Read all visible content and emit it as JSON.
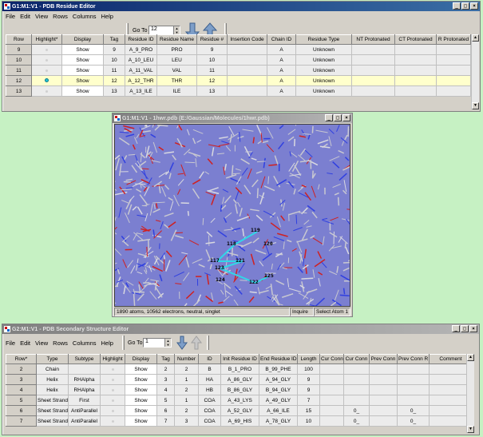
{
  "residue_editor": {
    "title": "G1:M1:V1 - PDB Residue Editor",
    "menu": [
      "File",
      "Edit",
      "View",
      "Rows",
      "Columns",
      "Help"
    ],
    "goto_label": "Go To",
    "goto_value": "12",
    "columns": [
      "Row",
      "Highlight*",
      "Display",
      "Tag",
      "Residue ID",
      "Residue Name",
      "Residue #",
      "Insertion Code",
      "Chain ID",
      "Residue Type",
      "NT Protonated",
      "CT Protonated",
      "R Protonated"
    ],
    "rows": [
      {
        "row": "9",
        "highlight": false,
        "display": "Show",
        "tag": "9",
        "id": "A_9_PRO",
        "name": "PRO",
        "num": "9",
        "ins": "",
        "chain": "A",
        "type": "Unknown"
      },
      {
        "row": "10",
        "highlight": false,
        "display": "Show",
        "tag": "10",
        "id": "A_10_LEU",
        "name": "LEU",
        "num": "10",
        "ins": "",
        "chain": "A",
        "type": "Unknown"
      },
      {
        "row": "11",
        "highlight": false,
        "display": "Show",
        "tag": "11",
        "id": "A_11_VAL",
        "name": "VAL",
        "num": "11",
        "ins": "",
        "chain": "A",
        "type": "Unknown"
      },
      {
        "row": "12",
        "highlight": true,
        "display": "Show",
        "tag": "12",
        "id": "A_12_THR",
        "name": "THR",
        "num": "12",
        "ins": "",
        "chain": "A",
        "type": "Unknown"
      },
      {
        "row": "13",
        "highlight": false,
        "display": "Show",
        "tag": "13",
        "id": "A_13_ILE",
        "name": "ILE",
        "num": "13",
        "ins": "",
        "chain": "A",
        "type": "Unknown"
      }
    ]
  },
  "molecule_view": {
    "title": "G1:M1:V1 - 1hwr.pdb (E:/Gaussian/Molecules/1hwr.pdb)",
    "labels": [
      "119",
      "118",
      "120",
      "117",
      "121",
      "123",
      "124",
      "122",
      "125"
    ],
    "status_info": "1890 atoms, 10562 electrons, neutral, singlet",
    "status_mode": "Inquire",
    "status_action": "Select Atom 1"
  },
  "secondary_editor": {
    "title": "G2:M1:V1 - PDB Secondary Structure Editor",
    "menu": [
      "File",
      "Edit",
      "View",
      "Rows",
      "Columns",
      "Help"
    ],
    "goto_label": "Go To",
    "goto_value": "1",
    "columns": [
      "Row*",
      "Type",
      "Subtype",
      "Highlight",
      "Display",
      "Tag",
      "Number",
      "ID",
      "Init Residue ID",
      "End Residue ID",
      "Length",
      "Cur Conn",
      "Cur Conn",
      "Prev Conn",
      "Prev Conn R",
      "Comment"
    ],
    "rows": [
      {
        "row": "2",
        "type": "Chain",
        "subtype": "",
        "display": "Show",
        "tag": "2",
        "number": "2",
        "id": "B",
        "init": "B_1_PRO",
        "end": "B_99_PHE",
        "length": "100",
        "c1": "",
        "c2": "",
        "p1": "",
        "p2": ""
      },
      {
        "row": "3",
        "type": "Helix",
        "subtype": "RHAlpha",
        "display": "Show",
        "tag": "3",
        "number": "1",
        "id": "HA",
        "init": "A_86_GLY",
        "end": "A_94_GLY",
        "length": "9",
        "c1": "",
        "c2": "",
        "p1": "",
        "p2": ""
      },
      {
        "row": "4",
        "type": "Helix",
        "subtype": "RHAlpha",
        "display": "Show",
        "tag": "4",
        "number": "2",
        "id": "HB",
        "init": "B_86_GLY",
        "end": "B_94_GLY",
        "length": "9",
        "c1": "",
        "c2": "",
        "p1": "",
        "p2": ""
      },
      {
        "row": "5",
        "type": "Sheet Strand",
        "subtype": "First",
        "display": "Show",
        "tag": "5",
        "number": "1",
        "id": "COA",
        "init": "A_43_LYS",
        "end": "A_49_GLY",
        "length": "7",
        "c1": "",
        "c2": "",
        "p1": "",
        "p2": ""
      },
      {
        "row": "6",
        "type": "Sheet Strand",
        "subtype": "AntiParallel",
        "display": "Show",
        "tag": "6",
        "number": "2",
        "id": "COA",
        "init": "A_52_GLY",
        "end": "A_66_ILE",
        "length": "15",
        "c1": "",
        "c2": "0_",
        "p1": "",
        "p2": "0_"
      },
      {
        "row": "7",
        "type": "Sheet Strand",
        "subtype": "AntiParallel",
        "display": "Show",
        "tag": "7",
        "number": "3",
        "id": "COA",
        "init": "A_69_HIS",
        "end": "A_78_GLY",
        "length": "10",
        "c1": "",
        "c2": "0_",
        "p1": "",
        "p2": "0_"
      }
    ]
  }
}
